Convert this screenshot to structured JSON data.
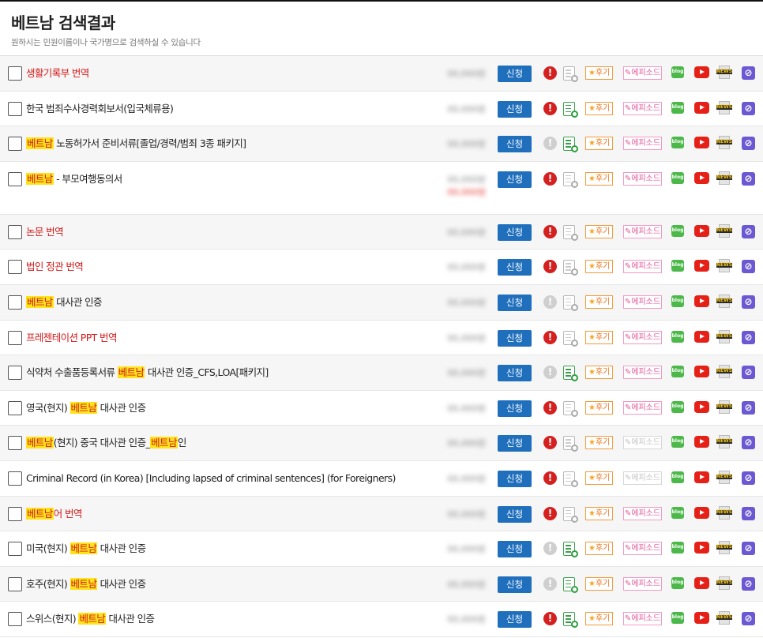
{
  "header": {
    "title": "베트남 검색결과",
    "subtitle": "원하시는 민원이름이나 국가명으로 검색하실 수 있습니다"
  },
  "labels": {
    "apply": "신청",
    "review": "후기",
    "episode": "에피소드",
    "blog": "blog",
    "news": "NEWS",
    "warn": "!",
    "link": "⊘"
  },
  "colors": {
    "apply_button": "#1f6fbd",
    "highlight": "#fde21c",
    "red_text": "#d31919",
    "warn_on": "#d52020",
    "link_icon": "#6b58d3"
  },
  "rows": [
    {
      "segments": [
        {
          "text": "생활기록부 번역",
          "hl": false
        }
      ],
      "red": true,
      "shaded": true,
      "warn": true,
      "doc_active": false,
      "episode_active": true,
      "price_hidden": true
    },
    {
      "segments": [
        {
          "text": "한국 범죄수사경력회보서(입국체류용)",
          "hl": false
        }
      ],
      "red": false,
      "shaded": false,
      "warn": true,
      "doc_active": true,
      "episode_active": true,
      "price_hidden": true
    },
    {
      "segments": [
        {
          "text": "베트남",
          "hl": true
        },
        {
          "text": " 노동허가서 준비서류[졸업/경력/범죄 3종 패키지]",
          "hl": false
        }
      ],
      "red": false,
      "shaded": true,
      "warn": false,
      "doc_active": true,
      "episode_active": true,
      "price_hidden": true
    },
    {
      "segments": [
        {
          "text": "베트남",
          "hl": true
        },
        {
          "text": " - 부모여행동의서",
          "hl": false
        }
      ],
      "red": false,
      "shaded": false,
      "warn": true,
      "doc_active": false,
      "episode_active": true,
      "price_hidden": true,
      "tall": true
    },
    {
      "segments": [
        {
          "text": "논문 번역",
          "hl": false
        }
      ],
      "red": true,
      "shaded": true,
      "warn": true,
      "doc_active": false,
      "episode_active": true,
      "price_hidden": true
    },
    {
      "segments": [
        {
          "text": "법인 정관 번역",
          "hl": false
        }
      ],
      "red": true,
      "shaded": false,
      "warn": true,
      "doc_active": false,
      "episode_active": true,
      "price_hidden": true
    },
    {
      "segments": [
        {
          "text": "베트남",
          "hl": true
        },
        {
          "text": " 대사관 인증",
          "hl": false
        }
      ],
      "red": false,
      "shaded": true,
      "warn": false,
      "doc_active": false,
      "episode_active": true,
      "price_hidden": true
    },
    {
      "segments": [
        {
          "text": "프레젠테이션 PPT 번역",
          "hl": false
        }
      ],
      "red": true,
      "shaded": false,
      "warn": true,
      "doc_active": false,
      "episode_active": true,
      "price_hidden": true
    },
    {
      "segments": [
        {
          "text": "식약처 수출품등록서류 ",
          "hl": false
        },
        {
          "text": "베트남",
          "hl": true
        },
        {
          "text": " 대사관 인증_CFS,LOA[패키지]",
          "hl": false
        }
      ],
      "red": false,
      "shaded": true,
      "warn": false,
      "doc_active": true,
      "episode_active": true,
      "price_hidden": true
    },
    {
      "segments": [
        {
          "text": "영국(현지) ",
          "hl": false
        },
        {
          "text": "베트남",
          "hl": true
        },
        {
          "text": " 대사관 인증",
          "hl": false
        }
      ],
      "red": false,
      "shaded": false,
      "warn": true,
      "doc_active": false,
      "episode_active": true,
      "price_hidden": true
    },
    {
      "segments": [
        {
          "text": "베트남",
          "hl": true
        },
        {
          "text": "(현지) 중국 대사관 인증_",
          "hl": false
        },
        {
          "text": "베트남",
          "hl": true
        },
        {
          "text": "인",
          "hl": false
        }
      ],
      "red": false,
      "shaded": true,
      "warn": true,
      "doc_active": false,
      "episode_active": false,
      "price_hidden": true
    },
    {
      "segments": [
        {
          "text": "Criminal Record (in Korea) [Including lapsed of criminal sentences] (for Foreigners)",
          "hl": false
        }
      ],
      "red": false,
      "shaded": false,
      "warn": true,
      "doc_active": false,
      "episode_active": false,
      "price_hidden": true
    },
    {
      "segments": [
        {
          "text": "베트남",
          "hl": true
        },
        {
          "text": "어 번역",
          "hl": false
        }
      ],
      "red": true,
      "shaded": true,
      "warn": true,
      "doc_active": false,
      "episode_active": true,
      "price_hidden": true
    },
    {
      "segments": [
        {
          "text": "미국(현지) ",
          "hl": false
        },
        {
          "text": "베트남",
          "hl": true
        },
        {
          "text": " 대사관 인증",
          "hl": false
        }
      ],
      "red": false,
      "shaded": false,
      "warn": false,
      "doc_active": true,
      "episode_active": true,
      "price_hidden": true
    },
    {
      "segments": [
        {
          "text": "호주(현지) ",
          "hl": false
        },
        {
          "text": "베트남",
          "hl": true
        },
        {
          "text": " 대사관 인증",
          "hl": false
        }
      ],
      "red": false,
      "shaded": true,
      "warn": false,
      "doc_active": true,
      "episode_active": true,
      "price_hidden": true
    },
    {
      "segments": [
        {
          "text": "스위스(현지) ",
          "hl": false
        },
        {
          "text": "베트남",
          "hl": true
        },
        {
          "text": " 대사관 인증",
          "hl": false
        }
      ],
      "red": false,
      "shaded": false,
      "warn": true,
      "doc_active": true,
      "episode_active": true,
      "price_hidden": true
    }
  ]
}
